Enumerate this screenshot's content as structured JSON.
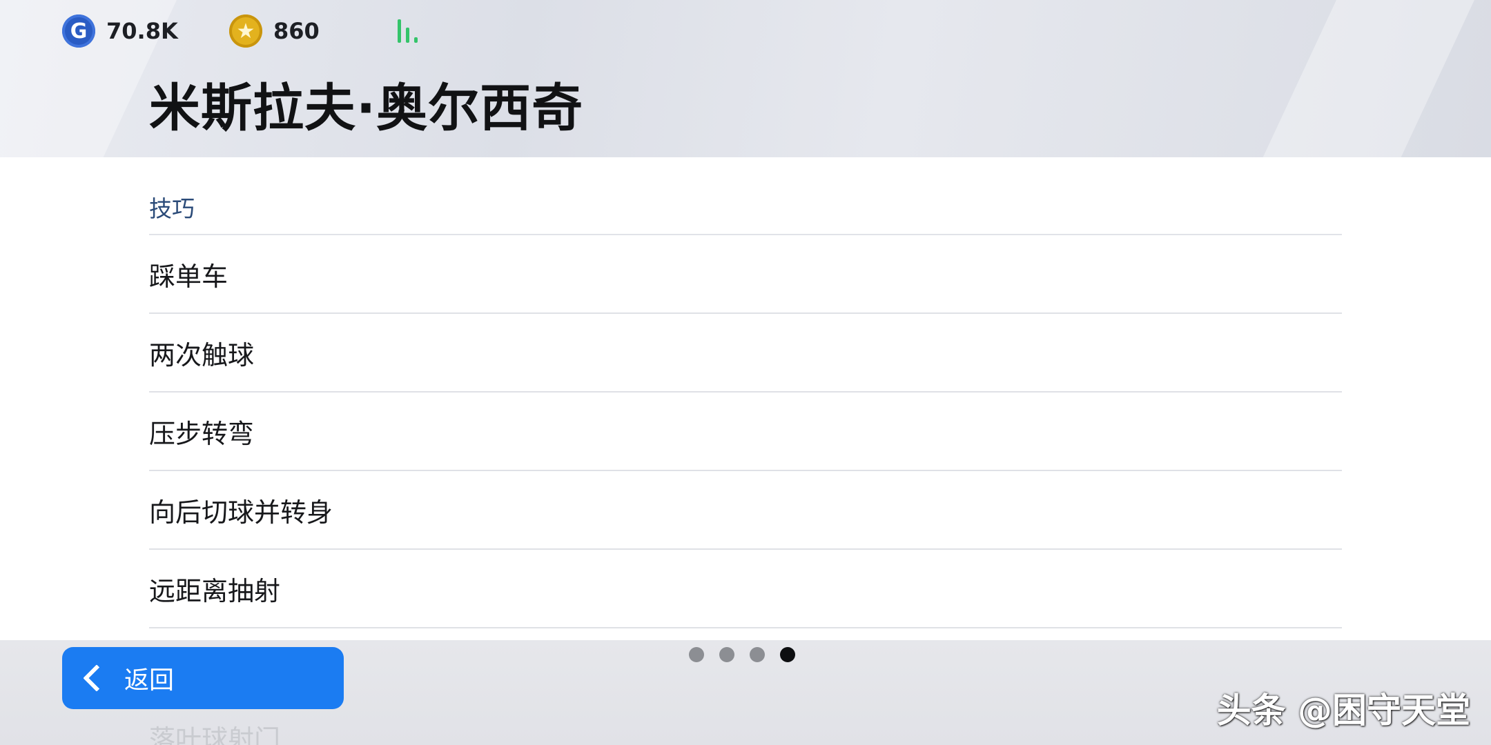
{
  "hud": {
    "gp_value": "70.8K",
    "coin_value": "860",
    "gp_icon": "G",
    "coin_icon": "★",
    "signal_icon": "signal-bars-icon"
  },
  "player": {
    "name": "米斯拉夫·奥尔西奇"
  },
  "skills": {
    "section_title": "技巧",
    "items": [
      "踩单车",
      "两次触球",
      "压步转弯",
      "向后切球并转身",
      "远距离抽射"
    ],
    "partial_item": "落叶球射门"
  },
  "footer": {
    "back_label": "返回",
    "pages": {
      "total": 4,
      "current": 4
    }
  },
  "watermark": "头条 @困守天堂",
  "colors": {
    "accent": "#1b7cf2",
    "section_title": "#2a4a78",
    "signal": "#34c46a"
  }
}
